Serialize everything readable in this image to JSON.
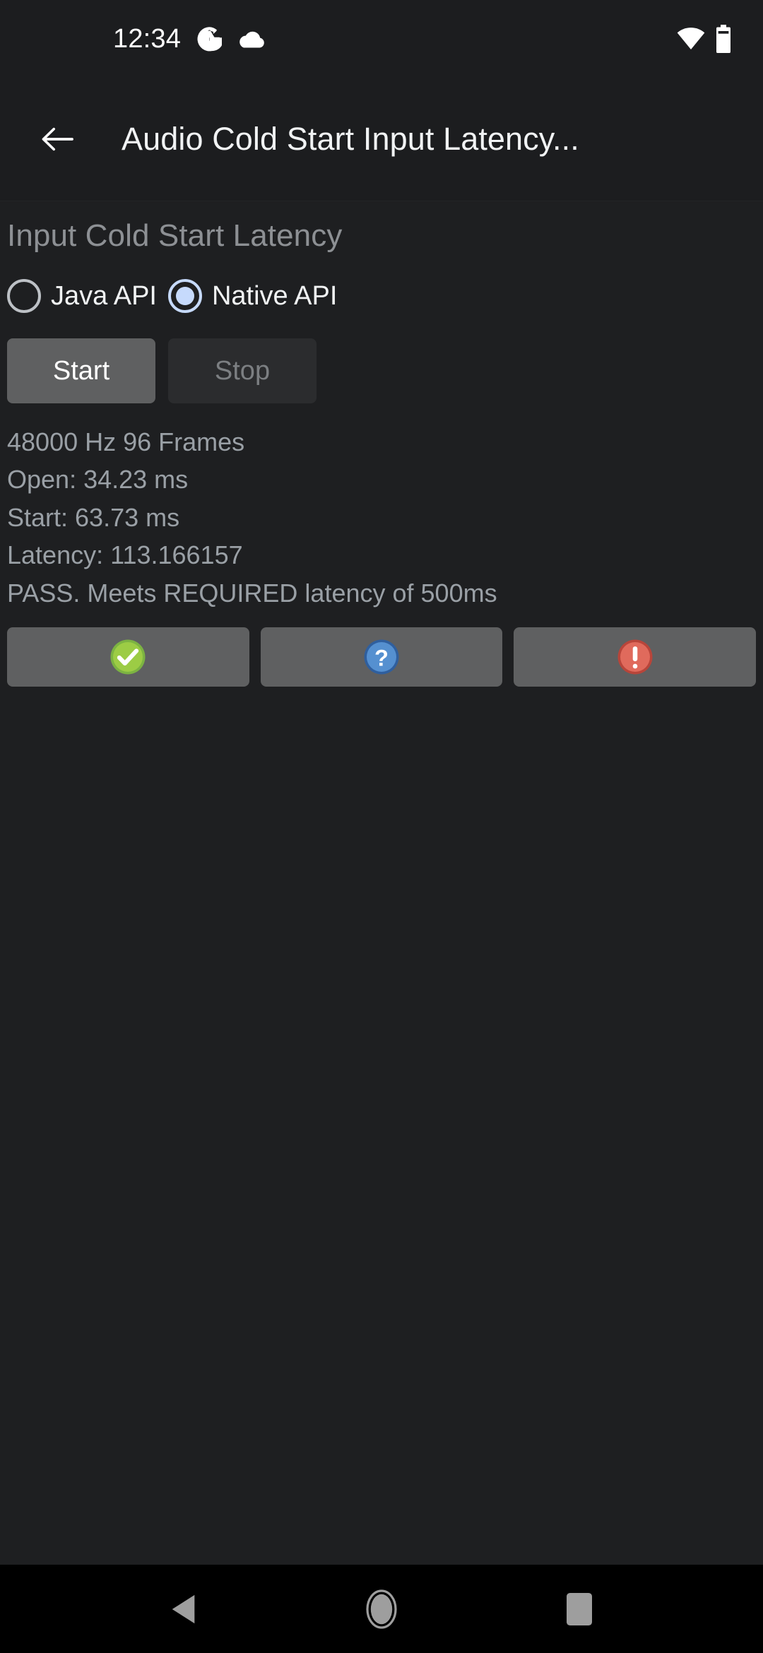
{
  "status_bar": {
    "time": "12:34",
    "icons": [
      "google-g-icon",
      "cloud-icon"
    ],
    "right_icons": [
      "wifi-icon",
      "battery-icon"
    ]
  },
  "app_bar": {
    "back_label": "back-arrow-icon",
    "title": "Audio Cold Start Input Latency..."
  },
  "main": {
    "section_title": "Input Cold Start Latency",
    "radios": [
      {
        "label": "Java API",
        "selected": false
      },
      {
        "label": "Native API",
        "selected": true
      }
    ],
    "buttons": [
      {
        "label": "Start",
        "enabled": true
      },
      {
        "label": "Stop",
        "enabled": false
      }
    ],
    "results": [
      "48000 Hz 96 Frames",
      "Open: 34.23 ms",
      "Start: 63.73 ms",
      "Latency: 113.166157",
      "PASS. Meets REQUIRED latency of 500ms"
    ],
    "verdict_buttons": [
      {
        "icon": "pass-check-icon",
        "color": "#8bc34a"
      },
      {
        "icon": "info-question-icon",
        "color": "#4a82c8"
      },
      {
        "icon": "fail-exclamation-icon",
        "color": "#d9564a"
      }
    ]
  },
  "nav_bar": {
    "items": [
      "back-triangle-icon",
      "home-circle-icon",
      "recents-square-icon"
    ]
  },
  "colors": {
    "background": "#1e1f21",
    "app_bar": "#1c1d1f",
    "nav_bar": "#000000",
    "accent_selected": "#c6dafc",
    "text_primary": "#f1f3f4",
    "text_secondary": "#9aa0a6",
    "button_enabled": "#5f6061",
    "button_disabled": "#2b2c2e"
  }
}
